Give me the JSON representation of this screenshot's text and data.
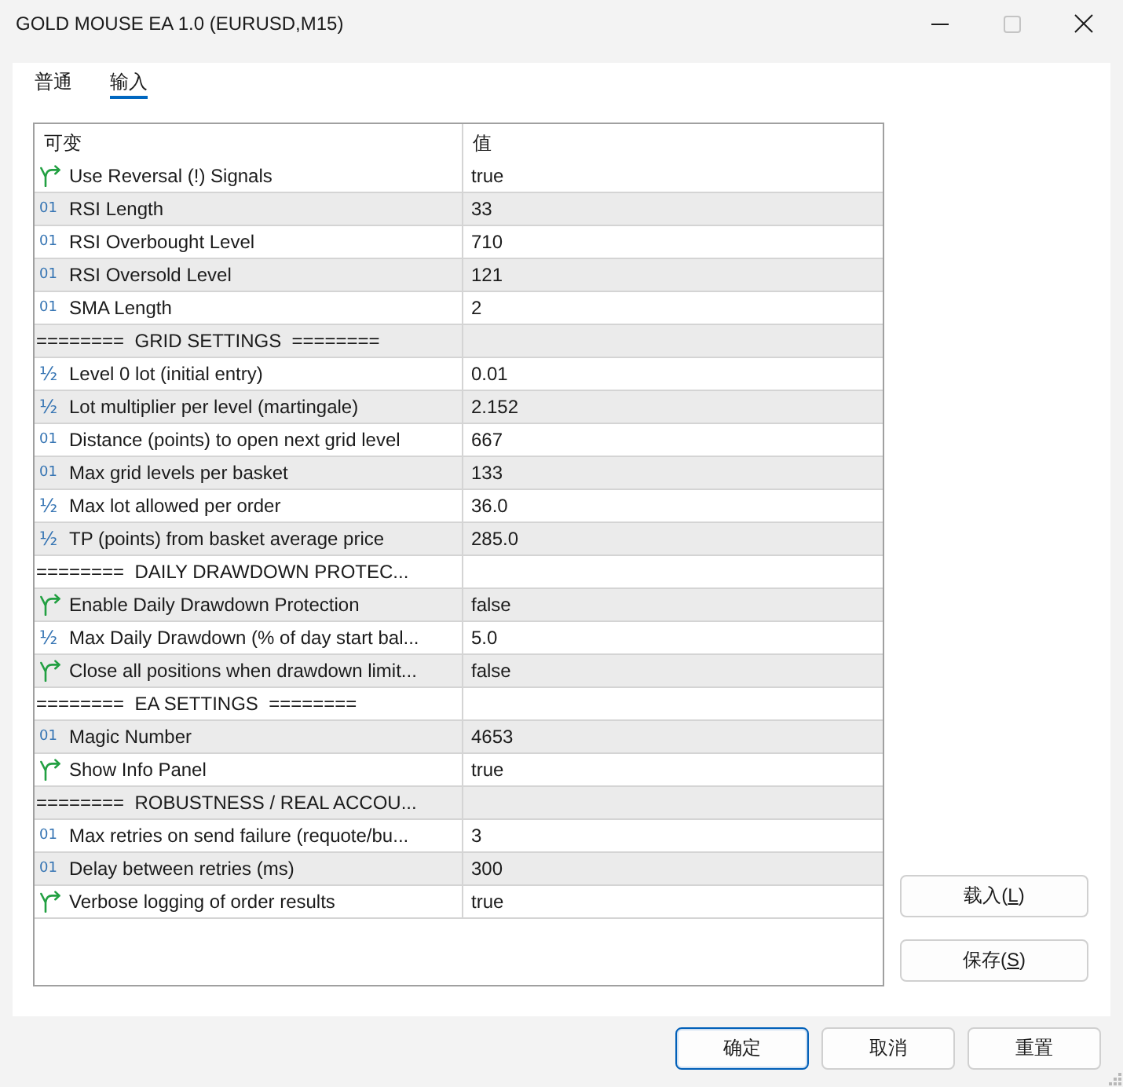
{
  "window": {
    "title": "GOLD MOUSE EA 1.0 (EURUSD,M15)",
    "controls": [
      {
        "kind": "minimize",
        "disabled": false
      },
      {
        "kind": "maximize",
        "disabled": true
      },
      {
        "kind": "close",
        "disabled": false
      }
    ]
  },
  "tabs": [
    {
      "label": "普通",
      "selected": false
    },
    {
      "label": "输入",
      "selected": true
    }
  ],
  "table": {
    "columns": [
      "可变",
      "值"
    ],
    "rows": [
      {
        "kind": "bool",
        "name": "Use Reversal (!) Signals",
        "value": "true"
      },
      {
        "kind": "int",
        "glyph": "01",
        "name": "RSI Length",
        "value": "33"
      },
      {
        "kind": "int",
        "glyph": "01",
        "name": "RSI Overbought Level",
        "value": "710"
      },
      {
        "kind": "int",
        "glyph": "01",
        "name": "RSI Oversold Level",
        "value": "121"
      },
      {
        "kind": "int",
        "glyph": "01",
        "name": "SMA Length",
        "value": "2"
      },
      {
        "kind": "separator",
        "name": "========  GRID SETTINGS  ========"
      },
      {
        "kind": "double",
        "glyph": "½",
        "name": "Level 0 lot (initial entry)",
        "value": "0.01"
      },
      {
        "kind": "double",
        "glyph": "½",
        "name": "Lot multiplier per level (martingale)",
        "value": "2.152"
      },
      {
        "kind": "int",
        "glyph": "01",
        "name": "Distance (points) to open next grid level",
        "value": "667"
      },
      {
        "kind": "int",
        "glyph": "01",
        "name": "Max grid levels per basket",
        "value": "133"
      },
      {
        "kind": "double",
        "glyph": "½",
        "name": "Max lot allowed per order",
        "value": "36.0"
      },
      {
        "kind": "double",
        "glyph": "½",
        "name": "TP (points) from basket average price",
        "value": "285.0"
      },
      {
        "kind": "separator",
        "name": "========  DAILY DRAWDOWN PROTEC..."
      },
      {
        "kind": "bool",
        "name": "Enable Daily Drawdown Protection",
        "value": "false"
      },
      {
        "kind": "double",
        "glyph": "½",
        "name": "Max Daily Drawdown (% of day start bal...",
        "value": "5.0"
      },
      {
        "kind": "bool",
        "name": "Close all positions when drawdown limit...",
        "value": "false"
      },
      {
        "kind": "separator",
        "name": "========  EA SETTINGS  ========"
      },
      {
        "kind": "int",
        "glyph": "01",
        "name": "Magic Number",
        "value": "4653"
      },
      {
        "kind": "bool",
        "name": "Show Info Panel",
        "value": "true"
      },
      {
        "kind": "separator",
        "name": "========  ROBUSTNESS / REAL ACCOU..."
      },
      {
        "kind": "int",
        "glyph": "01",
        "name": "Max retries on send failure (requote/bu...",
        "value": "3"
      },
      {
        "kind": "int",
        "glyph": "01",
        "name": "Delay between retries (ms)",
        "value": "300"
      },
      {
        "kind": "bool",
        "name": "Verbose logging of order results",
        "value": "true"
      }
    ]
  },
  "side_buttons": [
    {
      "parts": [
        {
          "text": "载入(",
          "underline": false
        },
        {
          "text": "L",
          "underline": true
        },
        {
          "text": ")",
          "underline": false
        }
      ]
    },
    {
      "parts": [
        {
          "text": "保存(",
          "underline": false
        },
        {
          "text": "S",
          "underline": true
        },
        {
          "text": ")",
          "underline": false
        }
      ]
    }
  ],
  "footer_buttons": [
    {
      "label": "确定",
      "default": true
    },
    {
      "label": "取消",
      "default": false
    },
    {
      "label": "重置",
      "default": false
    }
  ]
}
